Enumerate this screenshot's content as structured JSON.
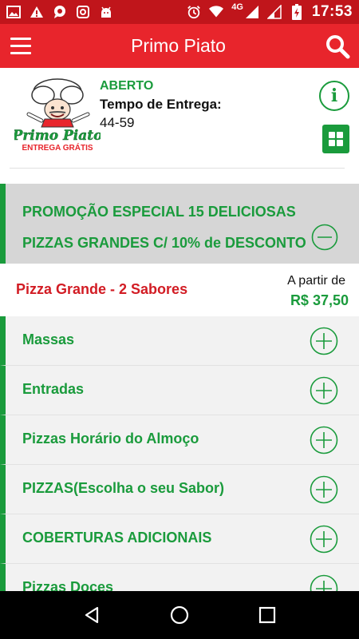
{
  "status_bar": {
    "time": "17:53",
    "network": "4G",
    "left_icons": [
      "image-icon",
      "warning-icon",
      "chat-icon",
      "instagram-icon",
      "android-icon"
    ],
    "right_icons": [
      "alarm-icon",
      "wifi-icon",
      "signal-icon",
      "signal-icon",
      "battery-charging-icon"
    ]
  },
  "app_bar": {
    "title": "Primo Piato",
    "menu_icon": "hamburger-icon",
    "search_icon": "search-icon",
    "color": "#e8252c"
  },
  "restaurant": {
    "logo_text": "Primo Piato",
    "logo_subtext": "ENTREGA GRÁTIS",
    "status": "ABERTO",
    "delivery_label": "Tempo de Entrega:",
    "delivery_time": "44-59"
  },
  "promo": {
    "title": "PROMOÇÃO ESPECIAL 15 DELICIOSAS PIZZAS GRANDES C/ 10% de DESCONTO",
    "expanded": true
  },
  "product": {
    "name": "Pizza Grande - 2 Sabores",
    "price_prefix": "A partir de",
    "price": "R$ 37,50"
  },
  "categories": [
    {
      "label": "Massas"
    },
    {
      "label": "Entradas"
    },
    {
      "label": "Pizzas Horário do Almoço"
    },
    {
      "label": "PIZZAS(Escolha o seu Sabor)"
    },
    {
      "label": "COBERTURAS ADICIONAIS"
    },
    {
      "label": "Pizzas Doces"
    }
  ],
  "colors": {
    "accent_green": "#1a9b3c",
    "brand_red": "#e8252c",
    "price_red": "#d21c24"
  }
}
